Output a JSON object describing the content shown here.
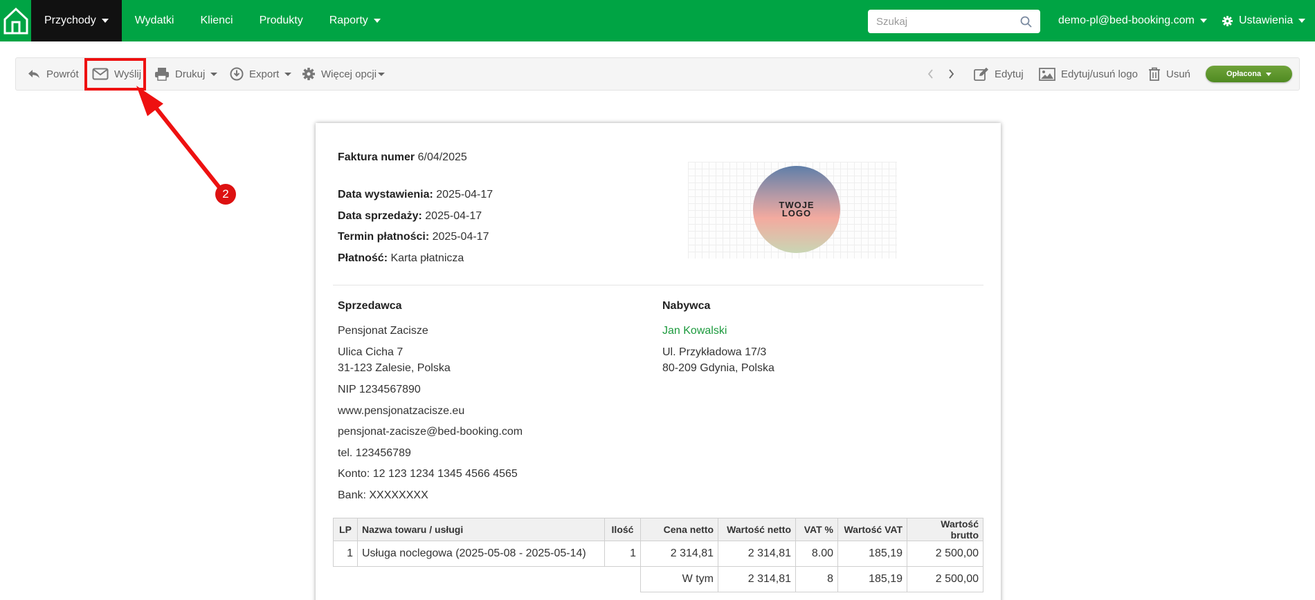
{
  "nav": {
    "items": [
      "Przychody",
      "Wydatki",
      "Klienci",
      "Produkty",
      "Raporty"
    ],
    "search_placeholder": "Szukaj",
    "user": "demo-pl@bed-booking.com",
    "settings": "Ustawienia"
  },
  "toolbar": {
    "back": "Powrót",
    "send": "Wyślij",
    "print": "Drukuj",
    "export": "Export",
    "more": "Więcej opcji",
    "edit": "Edytuj",
    "edit_logo": "Edytuj/usuń logo",
    "delete": "Usuń",
    "status": "Opłacona"
  },
  "annotation": {
    "step": "2"
  },
  "invoice": {
    "number_label": "Faktura numer",
    "number": "6/04/2025",
    "issue_label": "Data wystawienia:",
    "issue_date": "2025-04-17",
    "sale_label": "Data sprzedaży:",
    "sale_date": "2025-04-17",
    "due_label": "Termin płatności:",
    "due_date": "2025-04-17",
    "payment_label": "Płatność:",
    "payment": "Karta płatnicza",
    "logo_text": "TWOJE LOGO",
    "seller": {
      "heading": "Sprzedawca",
      "name": "Pensjonat Zacisze",
      "street": "Ulica Cicha 7",
      "city": "31-123 Zalesie, Polska",
      "nip": "NIP 1234567890",
      "www": "www.pensjonatzacisze.eu",
      "email": "pensjonat-zacisze@bed-booking.com",
      "tel": "tel. 123456789",
      "account": "Konto: 12 123 1234 1345 4566 4565",
      "bank": "Bank: XXXXXXXX"
    },
    "buyer": {
      "heading": "Nabywca",
      "name": "Jan Kowalski",
      "street": "Ul. Przykładowa 17/3",
      "city": "80-209 Gdynia, Polska"
    },
    "table": {
      "headers": [
        "LP",
        "Nazwa towaru / usługi",
        "Ilość",
        "Cena netto",
        "Wartość netto",
        "VAT %",
        "Wartość VAT",
        "Wartość brutto"
      ],
      "row": [
        "1",
        "Usługa noclegowa (2025-05-08 - 2025-05-14)",
        "1",
        "2 314,81",
        "2 314,81",
        "8.00",
        "185,19",
        "2 500,00"
      ],
      "subtotal": [
        "W tym",
        "2 314,81",
        "8",
        "185,19",
        "2 500,00"
      ]
    }
  }
}
